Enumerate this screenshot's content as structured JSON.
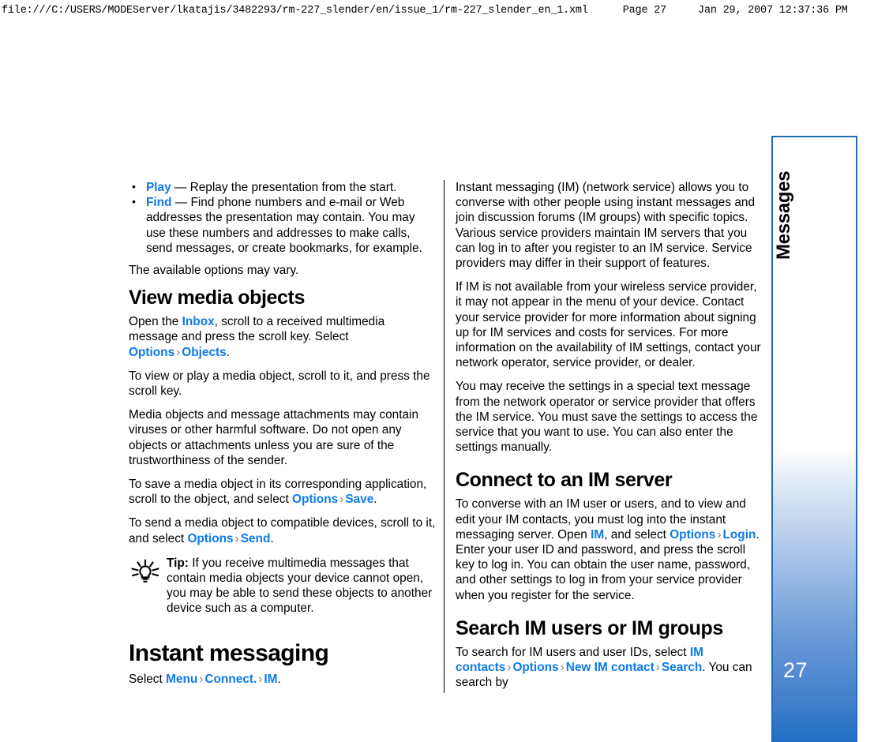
{
  "print_header": {
    "url": "file:///C:/USERS/MODEServer/lkatajis/3482293/rm-227_slender/en/issue_1/rm-227_slender_en_1.xml",
    "page": "Page 27",
    "date": "Jan 29, 2007 12:37:36 PM"
  },
  "chapter_tab": {
    "label": "Messages",
    "page_number": "27",
    "border_color": "#1f6cb5",
    "gradient_end_color": "#1d6ec4"
  },
  "link_color": "#0d7ae8",
  "left_column": {
    "bullets": [
      {
        "term": "Play",
        "dash": " — ",
        "text": "Replay the presentation from the start."
      },
      {
        "term": "Find",
        "dash": " — ",
        "text": "Find phone numbers and e-mail or Web addresses the presentation may contain. You may use these numbers and addresses to make calls, send messages, or create bookmarks, for example."
      }
    ],
    "options_vary": "The available options may vary.",
    "view_media_objects": {
      "heading": "View media objects",
      "p1_a": "Open the ",
      "p1_link1": "Inbox",
      "p1_b": ", scroll to a received multimedia message and press the scroll key. Select ",
      "p1_link2": "Options",
      "p1_sep": "›",
      "p1_link3": "Objects",
      "p1_c": ".",
      "p2": "To view or play a media object, scroll to it, and press the scroll key.",
      "p3": "Media objects and message attachments may contain viruses or other harmful software. Do not open any objects or attachments unless you are sure of the trustworthiness of the sender.",
      "p4_a": "To save a media object in its corresponding application, scroll to the object, and select ",
      "p4_link1": "Options",
      "p4_sep": "›",
      "p4_link2": "Save",
      "p4_b": ".",
      "p5_a": "To send a media object to compatible devices, scroll to it, and select ",
      "p5_link1": "Options",
      "p5_sep": "›",
      "p5_link2": "Send",
      "p5_b": ".",
      "tip_label": "Tip:",
      "tip_text": " If you receive multimedia messages that contain media objects your device cannot open, you may be able to send these objects to another device such as a computer.",
      "tip_icon": "lightbulb-icon"
    },
    "instant_messaging": {
      "heading": "Instant messaging",
      "select_a": "Select ",
      "link1": "Menu",
      "sep1": "›",
      "link2": "Connect.",
      "sep2": "›",
      "link3": "IM",
      "select_b": "."
    }
  },
  "right_column": {
    "p1": "Instant messaging (IM) (network service) allows you to converse with other people using instant messages and join discussion forums (IM groups) with specific topics. Various service providers maintain IM servers that you can log in to after you register to an IM service. Service providers may differ in their support of features.",
    "p2": "If IM is not available from your wireless service provider, it may not appear in the menu of your device. Contact your service provider for more information about signing up for IM services and costs for services. For more information on the availability of IM settings, contact your network operator, service provider, or dealer.",
    "p3": "You may receive the settings in a special text message from the network operator or service provider that offers the IM service. You must save the settings to access the service that you want to use. You can also enter the settings manually.",
    "connect_to_im_server": {
      "heading": "Connect to an IM server",
      "p1_a": "To converse with an IM user or users, and to view and edit your IM contacts, you must log into the instant messaging server. Open ",
      "p1_link1": "IM",
      "p1_b": ", and select ",
      "p1_link2": "Options",
      "p1_sep": "›",
      "p1_link3": "Login",
      "p1_c": ". Enter your user ID and password, and press the scroll key to log in. You can obtain the user name, password, and other settings to log in from your service provider when you register for the service."
    },
    "search_im_users": {
      "heading": "Search IM users or IM groups",
      "p1_a": "To search for IM users and user IDs, select ",
      "p1_link1": "IM contacts",
      "p1_sep1": "›",
      "p1_link2": "Options",
      "p1_sep2": "›",
      "p1_link3": "New IM contact",
      "p1_sep3": "›",
      "p1_link4": "Search",
      "p1_b": ". You can search by"
    }
  }
}
